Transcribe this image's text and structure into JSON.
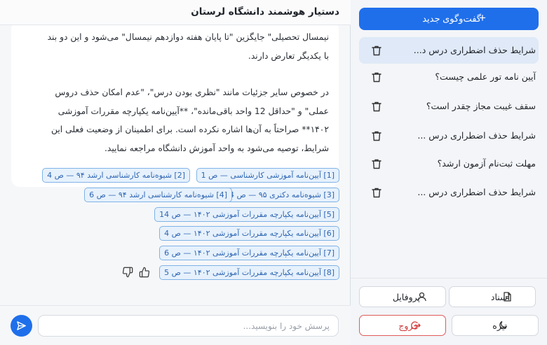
{
  "header": {
    "title": "دستیار هوشمند دانشگاه لرستان"
  },
  "message": {
    "lines": [
      "نیمسال تحصیلی\" جایگزین \"تا پایان هفته دوازدهم نیمسال\" می‌شود و این دو بند",
      "با یکدیگر تعارض دارند.",
      "در خصوص سایر جزئیات مانند \"نظری بودن درس\"، \"عدم امکان حذف دروس",
      "عملی\" و \"حداقل 12 واحد باقی‌مانده\"، **آیین‌نامه یکپارچه مقررات آموزشی",
      "۱۴۰۲** صراحتاً به آن‌ها اشاره نکرده است. برای اطمینان از وضعیت فعلی این",
      "شرایط، توصیه می‌شود به واحد آموزش دانشگاه مراجعه نمایید."
    ]
  },
  "citations": [
    "[1] آیین‌نامه آموزشی کارشناسی — ص 1",
    "[2] شیوه‌نامه کارشناسی ارشد ۹۴ — ص 4",
    "[3] شیوه‌نامه دکتری ۹۵ — ص 4",
    "[4] شیوه‌نامه کارشناسی ارشد ۹۴ — ص 6",
    "[5] آیین‌نامه یکپارچه مقررات آموزشی ۱۴۰۲ — ص 14",
    "[6] آیین‌نامه یکپارچه مقررات آموزشی ۱۴۰۲ — ص 4",
    "[7] آیین‌نامه یکپارچه مقررات آموزشی ۱۴۰۲ — ص 6",
    "[8] آیین‌نامه یکپارچه مقررات آموزشی ۱۴۰۲ — ص 5"
  ],
  "feedback": {
    "like_icon": "thumbs-up-icon",
    "dislike_icon": "thumbs-down-icon"
  },
  "composer": {
    "placeholder": "پرسش خود را بنویسید...",
    "send_icon": "send-icon"
  },
  "sidebar": {
    "new_chat_label": "گفت‌وگوی جدید",
    "new_chat_icon": "plus-icon",
    "chats": [
      {
        "title": "شرایط حذف اضطراری درس د...",
        "active": true
      },
      {
        "title": "آیین نامه تور علمی چیست؟",
        "active": false
      },
      {
        "title": "سقف غیبت مجاز چقدر است؟",
        "active": false
      },
      {
        "title": "شرایط حذف اضطراری درس ...",
        "active": false
      },
      {
        "title": "مهلت ثبت‌نام آزمون ارشد؟",
        "active": false
      },
      {
        "title": "شرایط حذف اضطراری درس ...",
        "active": false
      }
    ],
    "footer": {
      "docs_label": "اسناد",
      "profile_label": "پروفایل",
      "theme_label": "تیره",
      "logout_label": "خروج"
    }
  },
  "colors": {
    "accent": "#1f6feb",
    "citation_border": "#7fb3e6",
    "citation_text": "#2f66b3",
    "danger": "#d23a3a",
    "active_chat": "#dfe9f7"
  }
}
